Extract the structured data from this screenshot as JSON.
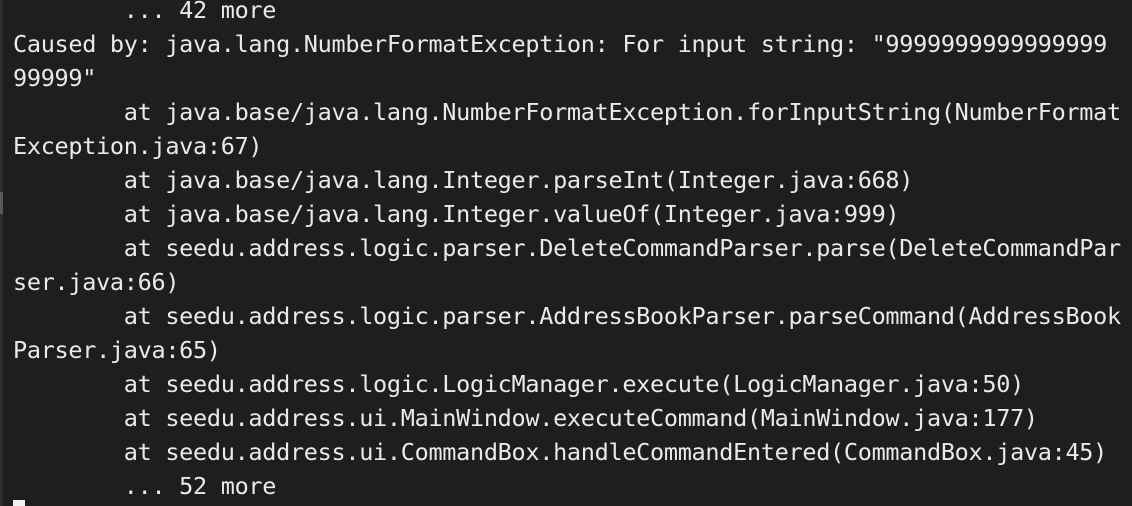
{
  "terminal": {
    "lines": [
      "        ... 42 more",
      "Caused by: java.lang.NumberFormatException: For input string: \"9999999999999999",
      "99999\"",
      "        at java.base/java.lang.NumberFormatException.forInputString(NumberFormat",
      "Exception.java:67)",
      "        at java.base/java.lang.Integer.parseInt(Integer.java:668)",
      "        at java.base/java.lang.Integer.valueOf(Integer.java:999)",
      "        at seedu.address.logic.parser.DeleteCommandParser.parse(DeleteCommandPar",
      "ser.java:66)",
      "        at seedu.address.logic.parser.AddressBookParser.parseCommand(AddressBook",
      "Parser.java:65)",
      "        at seedu.address.logic.LogicManager.execute(LogicManager.java:50)",
      "        at seedu.address.ui.MainWindow.executeCommand(MainWindow.java:177)",
      "        at seedu.address.ui.CommandBox.handleCommandEntered(CommandBox.java:45)",
      "        ... 52 more"
    ]
  }
}
